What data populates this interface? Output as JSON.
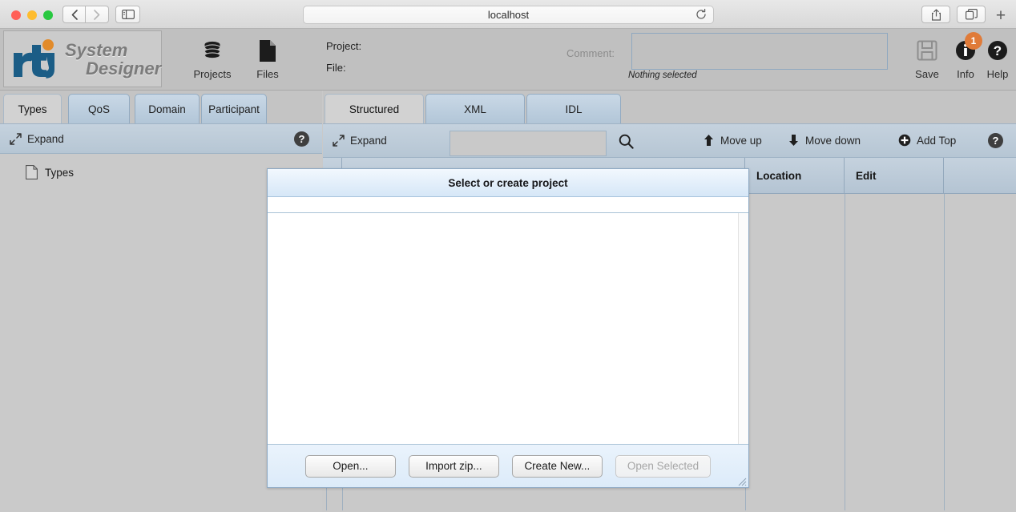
{
  "browser": {
    "url": "localhost",
    "back_icon": "chevron-left-icon",
    "forward_icon": "chevron-right-icon",
    "sidebar_icon": "sidebar-toggle-icon",
    "reload_icon": "reload-icon",
    "share_icon": "share-icon",
    "tabs_overview_icon": "tabs-overview-icon",
    "new_tab_label": "+"
  },
  "app": {
    "logo": {
      "brand": "rti",
      "line1": "System",
      "line2": "Designer"
    },
    "toolbar_left": [
      {
        "label": "Projects",
        "icon": "database-icon"
      },
      {
        "label": "Files",
        "icon": "file-icon"
      }
    ],
    "project_label": "Project:",
    "project_value": "",
    "file_label": "File:",
    "file_value": "",
    "comment_label": "Comment:",
    "comment_value": "",
    "comment_status": "Nothing selected",
    "toolbar_right": [
      {
        "label": "Save",
        "icon": "floppy-disk-icon",
        "badge": null
      },
      {
        "label": "Info",
        "icon": "info-icon",
        "badge": "1"
      },
      {
        "label": "Help",
        "icon": "question-circle-icon",
        "badge": null
      }
    ],
    "badge_color": "#e07b39"
  },
  "left_pane": {
    "tabs": [
      {
        "label": "Types",
        "active": true
      },
      {
        "label": "QoS",
        "active": false
      },
      {
        "label": "Domain",
        "active": false
      },
      {
        "label": "Participant",
        "active": false
      }
    ],
    "expand_label": "Expand",
    "expand_icon": "expand-arrows-icon",
    "help_icon": "question-circle-icon",
    "tree": [
      {
        "label": "Types",
        "icon": "file-icon"
      }
    ]
  },
  "right_pane": {
    "tabs": [
      {
        "label": "Structured",
        "active": true
      },
      {
        "label": "XML",
        "active": false
      },
      {
        "label": "IDL",
        "active": false
      }
    ],
    "expand_label": "Expand",
    "expand_icon": "expand-arrows-icon",
    "search_value": "",
    "search_placeholder": "",
    "search_icon": "search-icon",
    "actions": [
      {
        "label": "Move up",
        "icon": "arrow-up-icon"
      },
      {
        "label": "Move down",
        "icon": "arrow-down-icon"
      },
      {
        "label": "Add Top",
        "icon": "plus-circle-icon"
      }
    ],
    "help_icon": "question-circle-icon",
    "table_headers": [
      "",
      "",
      "Location",
      "Edit",
      ""
    ],
    "table_rows": []
  },
  "dialog": {
    "title": "Select or create project",
    "items": [],
    "buttons": [
      {
        "label": "Open...",
        "disabled": false
      },
      {
        "label": "Import zip...",
        "disabled": false
      },
      {
        "label": "Create New...",
        "disabled": false
      },
      {
        "label": "Open Selected",
        "disabled": true
      }
    ],
    "resize_icon": "resize-grip-icon"
  }
}
